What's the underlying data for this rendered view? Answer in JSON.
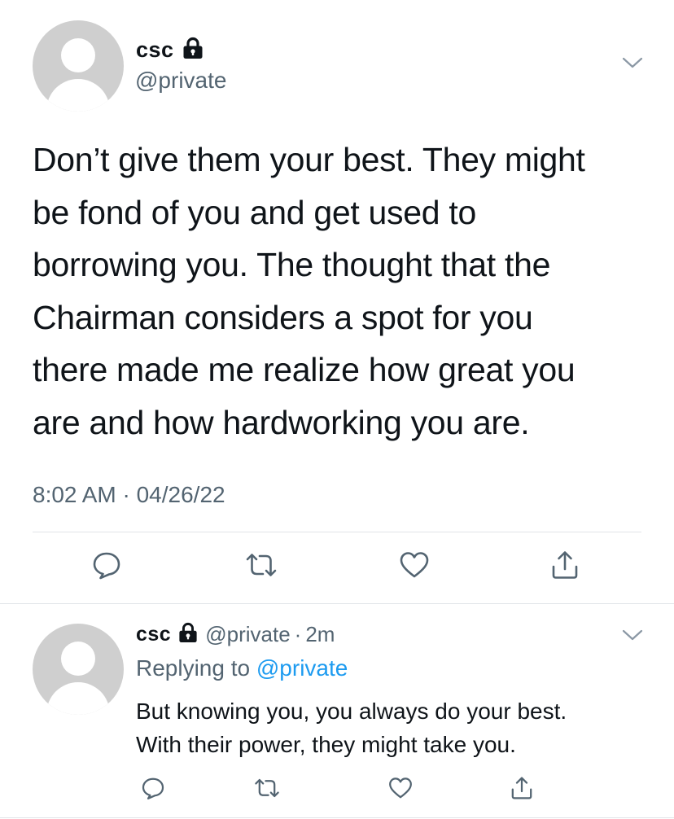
{
  "main_tweet": {
    "author_name": "csc",
    "author_handle": "@private",
    "text_lines": [
      "Don’t give them your best. They might",
      "be fond of you and get used to",
      "borrowing you. The thought that the",
      "Chairman considers a spot for you",
      "there made me realize how great you",
      "are and how hardworking you are."
    ],
    "timestamp": "8:02 AM · 04/26/22"
  },
  "reply": {
    "author_name": "csc",
    "author_handle": "@private",
    "separator": "·",
    "time_ago": "2m",
    "replying_prefix": "Replying to",
    "replying_to": "@private",
    "text_lines": [
      "But knowing you, you always do your best.",
      "With their power, they might take you."
    ]
  },
  "icons": {
    "reply": "comment-icon",
    "retweet": "retweet-icon",
    "like": "heart-icon",
    "share": "share-icon",
    "more": "chevron-down-icon",
    "protected": "lock-icon"
  },
  "colors": {
    "link": "#1d9bf0",
    "secondary_text": "#536471",
    "avatar_bg": "#cfcfcf"
  }
}
